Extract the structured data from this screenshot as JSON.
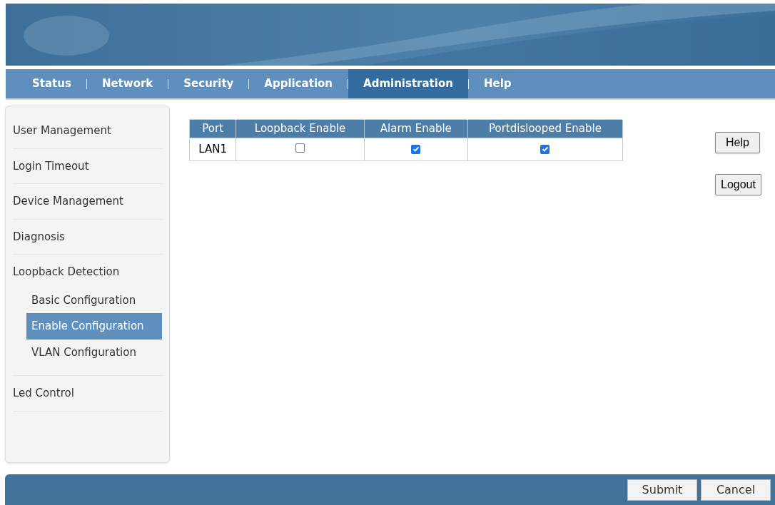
{
  "nav": {
    "tabs": [
      {
        "label": "Status",
        "selected": false
      },
      {
        "label": "Network",
        "selected": false
      },
      {
        "label": "Security",
        "selected": false
      },
      {
        "label": "Application",
        "selected": false
      },
      {
        "label": "Administration",
        "selected": true
      },
      {
        "label": "Help",
        "selected": false
      }
    ]
  },
  "sidebar": {
    "items": [
      {
        "label": "User Management",
        "selected": false
      },
      {
        "label": "Login Timeout",
        "selected": false
      },
      {
        "label": "Device Management",
        "selected": false
      },
      {
        "label": "Diagnosis",
        "selected": false
      },
      {
        "label": "Loopback Detection",
        "selected": false,
        "children": [
          {
            "label": "Basic Configuration",
            "selected": false
          },
          {
            "label": "Enable Configuration",
            "selected": true
          },
          {
            "label": "VLAN Configuration",
            "selected": false
          }
        ]
      },
      {
        "label": "Led Control",
        "selected": false
      }
    ]
  },
  "table": {
    "columns": [
      "Port",
      "Loopback Enable",
      "Alarm Enable",
      "Portdislooped Enable"
    ],
    "rows": [
      {
        "cells": [
          {
            "kind": "text",
            "text": "LAN1"
          },
          {
            "kind": "checkbox",
            "checked": false
          },
          {
            "kind": "checkbox",
            "checked": true
          },
          {
            "kind": "checkbox",
            "checked": true
          }
        ]
      }
    ]
  },
  "side_buttons": [
    "Help",
    "Logout"
  ],
  "footer": {
    "buttons": [
      "Submit",
      "Cancel"
    ]
  }
}
